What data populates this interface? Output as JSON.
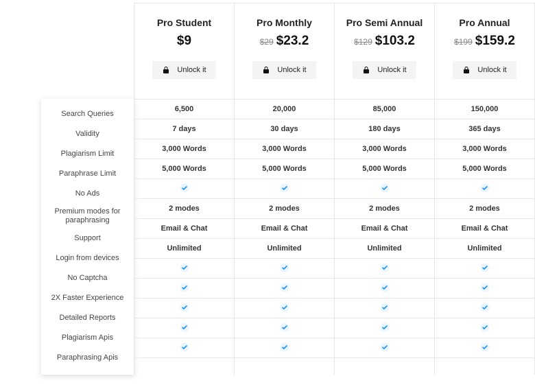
{
  "feature_labels": [
    "Search Queries",
    "Validity",
    "Plagiarism Limit",
    "Paraphrase Limit",
    "No Ads",
    "Premium modes for paraphrasing",
    "Support",
    "Login from devices",
    "No Captcha",
    "2X Faster Experience",
    "Detailed Reports",
    "Plagiarism Apis",
    "Paraphrasing Apis"
  ],
  "unlock_label": "Unlock it",
  "plans": [
    {
      "name": "Pro Student",
      "old_price": "",
      "price": "$9",
      "values": [
        "6,500",
        "7 days",
        "3,000 Words",
        "5,000 Words",
        "__check__",
        "2 modes",
        "Email & Chat",
        "Unlimited",
        "__check__",
        "__check__",
        "__check__",
        "__check__",
        "__check__"
      ]
    },
    {
      "name": "Pro Monthly",
      "old_price": "$29",
      "price": "$23.2",
      "values": [
        "20,000",
        "30 days",
        "3,000 Words",
        "5,000 Words",
        "__check__",
        "2 modes",
        "Email & Chat",
        "Unlimited",
        "__check__",
        "__check__",
        "__check__",
        "__check__",
        "__check__"
      ]
    },
    {
      "name": "Pro Semi Annual",
      "old_price": "$129",
      "price": "$103.2",
      "values": [
        "85,000",
        "180 days",
        "3,000 Words",
        "5,000 Words",
        "__check__",
        "2 modes",
        "Email & Chat",
        "Unlimited",
        "__check__",
        "__check__",
        "__check__",
        "__check__",
        "__check__"
      ]
    },
    {
      "name": "Pro Annual",
      "old_price": "$199",
      "price": "$159.2",
      "values": [
        "150,000",
        "365 days",
        "3,000 Words",
        "5,000 Words",
        "__check__",
        "2 modes",
        "Email & Chat",
        "Unlimited",
        "__check__",
        "__check__",
        "__check__",
        "__check__",
        "__check__"
      ]
    }
  ]
}
